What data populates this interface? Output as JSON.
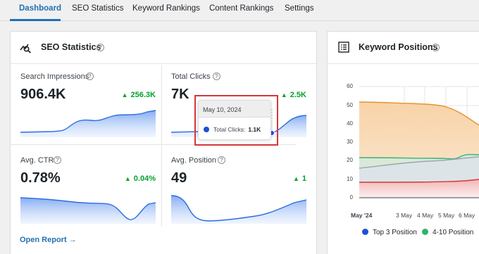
{
  "tabs": [
    {
      "label": "Dashboard",
      "active": true
    },
    {
      "label": "SEO Statistics"
    },
    {
      "label": "Keyword Rankings"
    },
    {
      "label": "Content Rankings"
    },
    {
      "label": "Settings"
    }
  ],
  "seo_panel": {
    "title": "SEO Statistics",
    "help_glyph": "?",
    "metrics": [
      {
        "label": "Search Impressions",
        "value": "906.4K",
        "change": "256.3K",
        "trend": "up"
      },
      {
        "label": "Total Clicks",
        "value": "7K",
        "change": "2.5K",
        "trend": "up"
      },
      {
        "label": "Avg. CTR",
        "value": "0.78%",
        "change": "0.04%",
        "trend": "up"
      },
      {
        "label": "Avg. Position",
        "value": "49",
        "change": "1",
        "trend": "up"
      }
    ],
    "tooltip": {
      "date": "May 10, 2024",
      "label": "Total Clicks:",
      "value": "1.1K"
    },
    "open_report": "Open Report →"
  },
  "keyword_panel": {
    "title": "Keyword Positions",
    "help_glyph": "?",
    "y_ticks": [
      "60",
      "50",
      "40",
      "30",
      "20",
      "10",
      "0"
    ],
    "x_ticks": [
      "May '24",
      "3 May",
      "4 May",
      "5 May",
      "6 May"
    ],
    "legend": [
      {
        "label": "Top 3 Position",
        "color": "#1e4fd8"
      },
      {
        "label": "4-10 Position",
        "color": "#2fb36b"
      }
    ]
  },
  "colors": {
    "accent": "#2271b1",
    "positive": "#00a32a",
    "orange": "#e8912c",
    "green": "#3bb273",
    "red": "#d63638",
    "gray": "#9aa6b2"
  }
}
